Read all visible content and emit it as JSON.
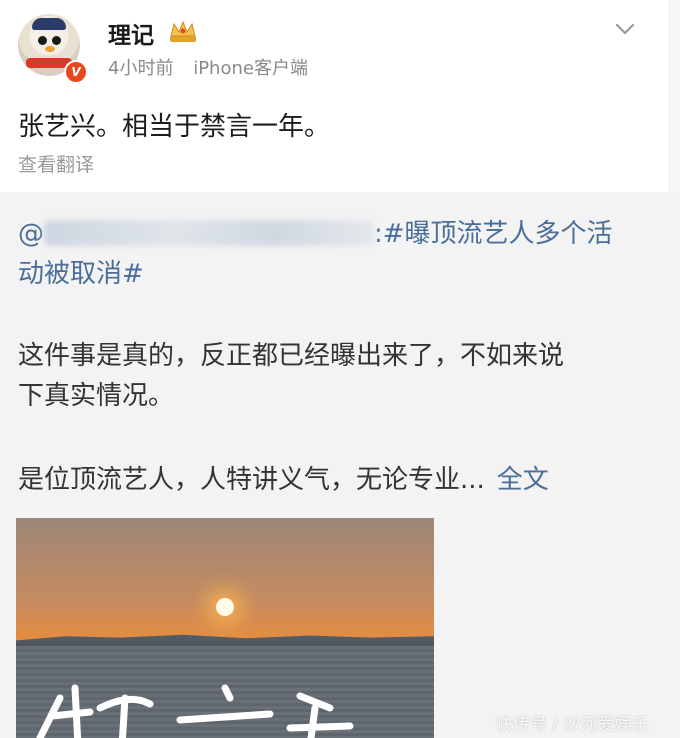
{
  "post": {
    "username": "理记",
    "time": "4小时前",
    "source": "iPhone客户端",
    "text": "张艺兴。相当于禁言一年。",
    "translate_label": "查看翻译",
    "verified_badge": "V"
  },
  "repost": {
    "mention_prefix": "@",
    "topic_line1": "#曝顶流艺人多个活",
    "topic_line2": "动被取消#",
    "para1_line1": "这件事是真的，反正都已经曝出来了，不如来说",
    "para1_line2": "下真实情况。",
    "para2": "是位顶流艺人，人特讲义气，无论专业...",
    "full_text_link": "全文"
  },
  "watermark": "快传号 / 沙河爱娱乐",
  "icons": {
    "crown": "crown-icon",
    "chevron": "chevron-down-icon"
  },
  "colors": {
    "link": "#4a6e9a",
    "badge": "#e8491d"
  }
}
